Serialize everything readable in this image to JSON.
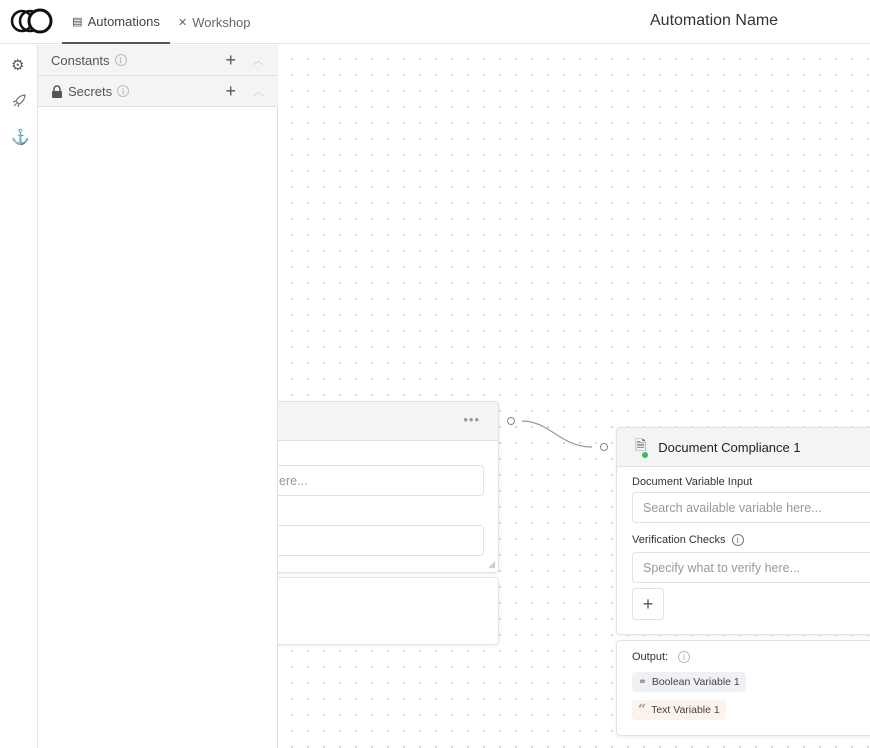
{
  "header": {
    "tabs": [
      {
        "label": "Automations",
        "icon": "table-icon"
      },
      {
        "label": "Workshop",
        "icon": "tools-icon"
      }
    ],
    "title": "Automation Name"
  },
  "rail": {
    "items": [
      "gear-icon",
      "rocket-icon",
      "anchor-icon"
    ]
  },
  "panel": {
    "sections": [
      {
        "label": "Constants"
      },
      {
        "label": "Secrets",
        "icon": "lock-icon"
      }
    ]
  },
  "left_node": {
    "input1_placeholder": "ere...",
    "menu": "•••"
  },
  "right_node": {
    "title": "Document Compliance 1",
    "doc_label": "Document Variable Input",
    "doc_placeholder": "Search available variable here...",
    "checks_label": "Verification Checks",
    "checks_placeholder": "Specify what to verify here...",
    "add": "+",
    "output_label": "Output:",
    "outputs": [
      {
        "label": "Boolean Variable 1",
        "color": "#f0f0f5"
      },
      {
        "label": "Text Variable 1",
        "color": "#fbf4ec"
      }
    ]
  }
}
